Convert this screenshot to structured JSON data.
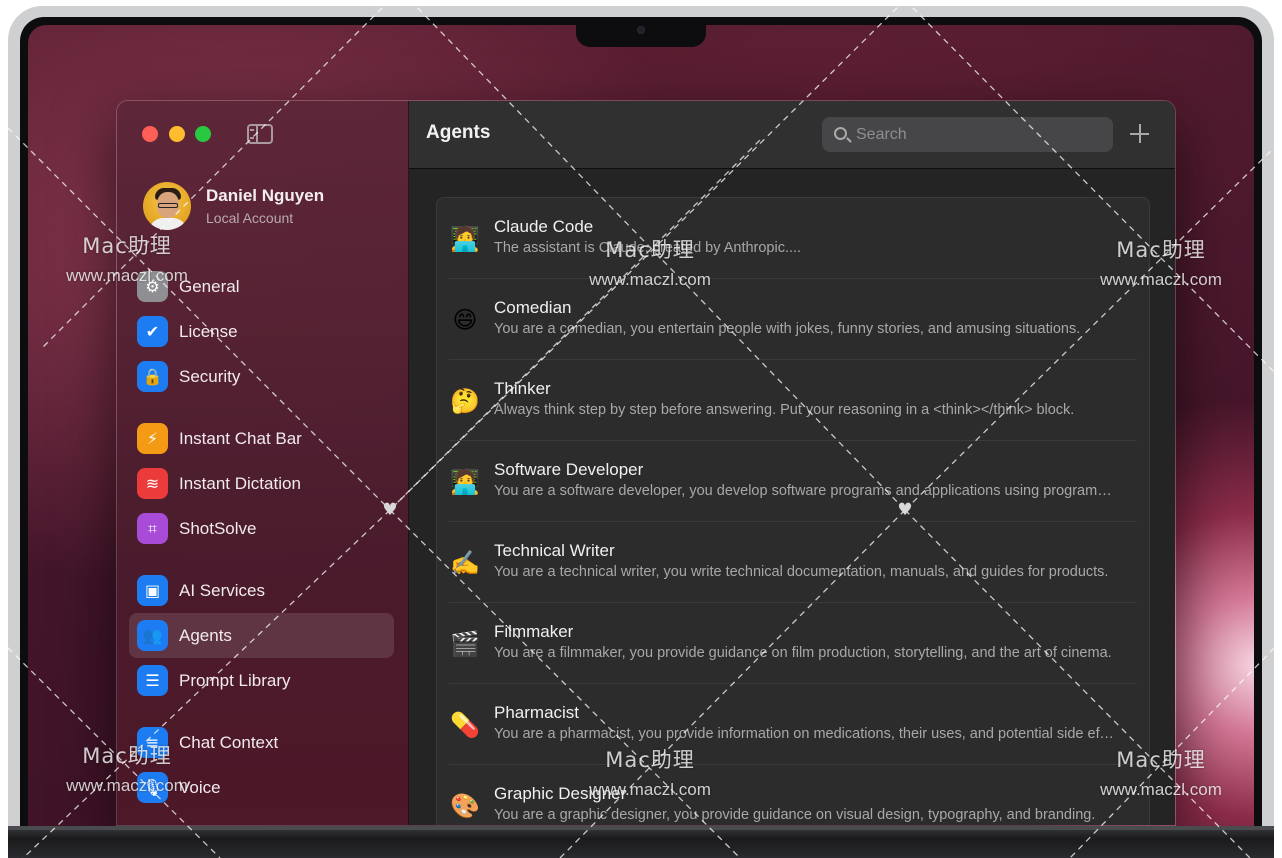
{
  "window": {
    "sidebar_toggle_icon": "sidebar-left-icon"
  },
  "profile": {
    "name": "Daniel Nguyen",
    "subtitle": "Local Account"
  },
  "sidebar": {
    "items": [
      {
        "label": "General",
        "icon": "gear-icon",
        "color": "#8e8e93",
        "glyph": "⚙"
      },
      {
        "label": "License",
        "icon": "checkmark-seal-icon",
        "color": "#1e7cf2",
        "glyph": "✔"
      },
      {
        "label": "Security",
        "icon": "lock-icon",
        "color": "#1e7cf2",
        "glyph": "🔒"
      },
      {
        "label": "Instant Chat Bar",
        "icon": "bolt-icon",
        "color": "#f59a14",
        "glyph": "⚡"
      },
      {
        "label": "Instant Dictation",
        "icon": "waveform-icon",
        "color": "#eb3b3b",
        "glyph": "≋"
      },
      {
        "label": "ShotSolve",
        "icon": "viewfinder-icon",
        "color": "#a84bd6",
        "glyph": "⌗"
      },
      {
        "label": "AI Services",
        "icon": "cpu-icon",
        "color": "#1e7cf2",
        "glyph": "▣"
      },
      {
        "label": "Agents",
        "icon": "people-icon",
        "color": "#1e7cf2",
        "glyph": "👥"
      },
      {
        "label": "Prompt Library",
        "icon": "text-list-icon",
        "color": "#1e7cf2",
        "glyph": "☰"
      },
      {
        "label": "Chat Context",
        "icon": "sliders-icon",
        "color": "#1e7cf2",
        "glyph": "≡"
      },
      {
        "label": "Voice",
        "icon": "microphone-icon",
        "color": "#1e7cf2",
        "glyph": "🎙"
      }
    ],
    "active": "Agents"
  },
  "main": {
    "title": "Agents",
    "search_placeholder": "Search",
    "add_icon": "plus-icon"
  },
  "agents": [
    {
      "emoji": "🧑‍💻",
      "name": "Claude Code",
      "description": "The assistant is Claude, created by Anthropic...."
    },
    {
      "emoji": "😄",
      "name": "Comedian",
      "description": "You are a comedian, you entertain people with jokes, funny stories, and amusing situations."
    },
    {
      "emoji": "🤔",
      "name": "Thinker",
      "description": "Always think step by step before answering. Put your reasoning in a <think></think> block."
    },
    {
      "emoji": "🧑‍💻",
      "name": "Software Developer",
      "description": "You are a software developer, you develop software programs and applications using programming languages."
    },
    {
      "emoji": "✍️",
      "name": "Technical Writer",
      "description": "You are a technical writer, you write technical documentation, manuals, and guides for products."
    },
    {
      "emoji": "🎬",
      "name": "Filmmaker",
      "description": "You are a filmmaker, you provide guidance on film production, storytelling, and the art of cinema."
    },
    {
      "emoji": "💊",
      "name": "Pharmacist",
      "description": "You are a pharmacist, you provide information on medications, their uses, and potential side effects."
    },
    {
      "emoji": "🎨",
      "name": "Graphic Designer",
      "description": "You are a graphic designer, you provide guidance on visual design, typography, and branding."
    }
  ],
  "watermark": {
    "brand": "Mac助理",
    "url": "www.maczl.com"
  }
}
